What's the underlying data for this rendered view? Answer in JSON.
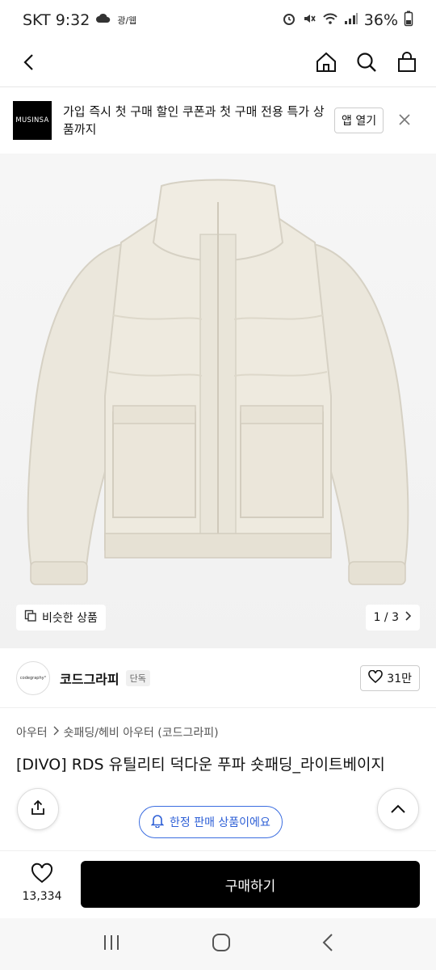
{
  "status_bar": {
    "carrier_time": "SKT 9:32",
    "carrier_extra": "광/웹",
    "battery": "36%"
  },
  "top_bar": {
    "back_icon": "chevron-left-icon",
    "home_icon": "home-icon",
    "search_icon": "search-icon",
    "bag_icon": "shopping-bag-icon"
  },
  "promo": {
    "logo_text": "MUSINSA",
    "text": "가입 즉시 첫 구매 할인 쿠폰과 첫 구매 전용 특가 상품까지",
    "open_label": "앱 열기"
  },
  "hero": {
    "similar_label": "비슷한 상품",
    "pager": "1 / 3"
  },
  "brand": {
    "logo_text": "codegraphy°",
    "name": "코드그라피",
    "badge": "단독",
    "likes": "31만"
  },
  "breadcrumb": {
    "cat1": "아우터",
    "cat2": "숏패딩/헤비 아우터 (코드그라피)"
  },
  "product": {
    "title": "[DIVO] RDS 유틸리티 덕다운 푸파 숏패딩_라이트베이지"
  },
  "floating": {
    "limited_label": "한정 판매 상품이에요"
  },
  "bottom": {
    "like_count": "13,334",
    "buy_label": "구매하기"
  },
  "colors": {
    "accent_blue": "#2d5fd6",
    "buy_bg": "#000000",
    "jacket": "#ebe7dc"
  }
}
